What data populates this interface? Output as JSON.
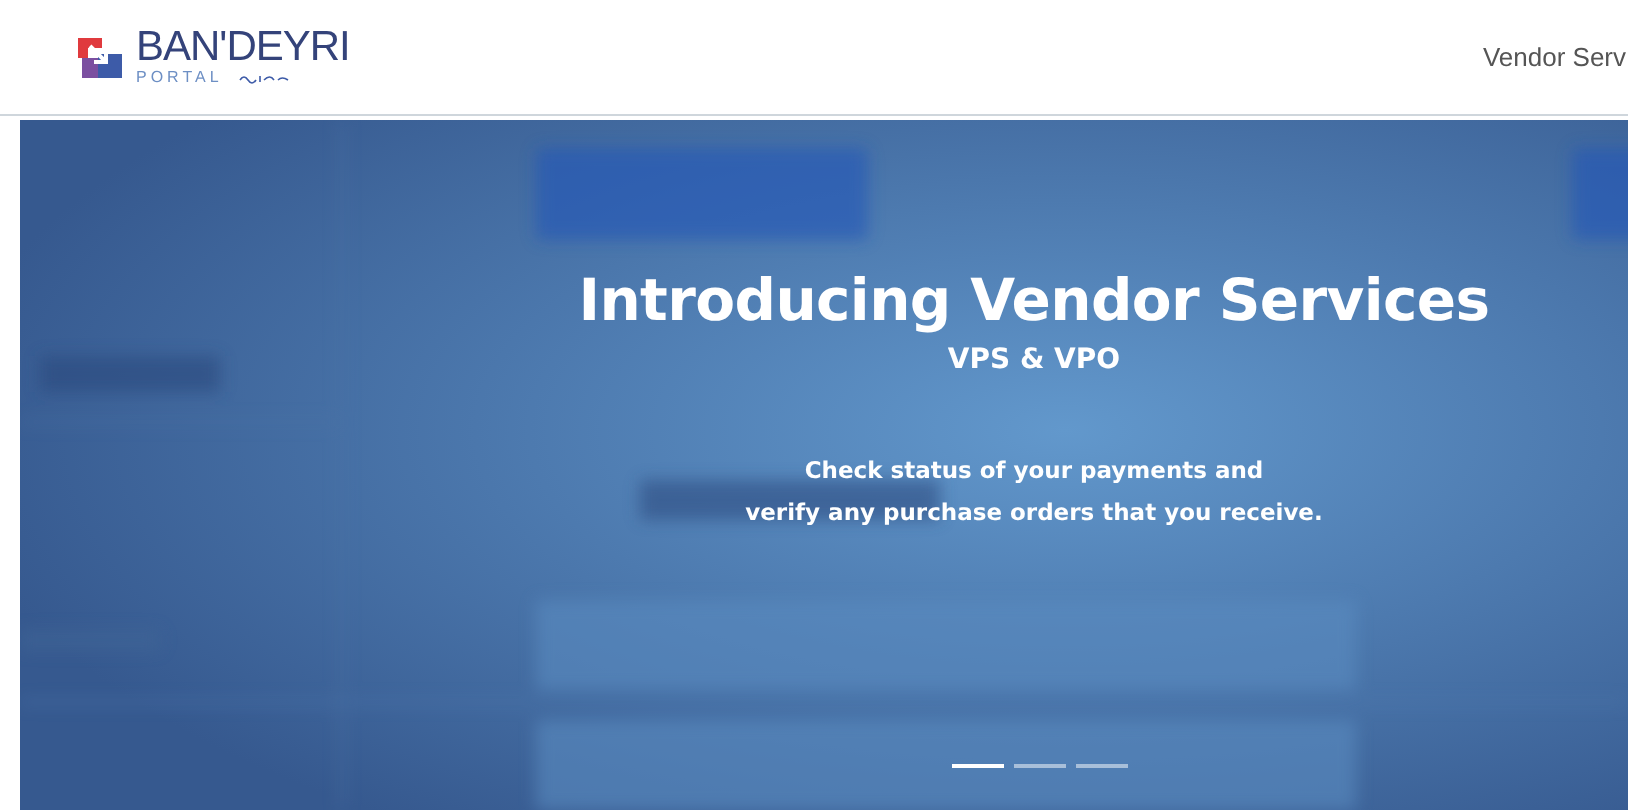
{
  "header": {
    "logo": {
      "name": "BAN'DEYRI",
      "subtitle": "PORTAL"
    },
    "nav": [
      {
        "label": "Vendor Serv"
      }
    ]
  },
  "carousel": {
    "slide": {
      "kind": "picture",
      "title": "Introducing Vendor Services",
      "subtitle": "VPS & VPO",
      "text": [
        "Check status of your payments and",
        "verify any purchase orders that you receive."
      ]
    },
    "indicators": [
      {
        "selected": true
      },
      {
        "selected": false
      },
      {
        "selected": false
      }
    ]
  }
}
